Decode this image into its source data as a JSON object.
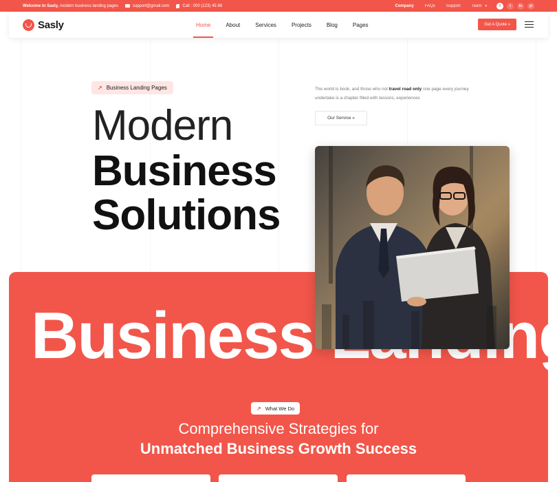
{
  "topbar": {
    "welcome_bold": "Welcome to Sasly,",
    "welcome_rest": "modern business landing pages",
    "email": "support@gmail.com",
    "phone": "Call : 000 (123) 45 88",
    "links": [
      "Company",
      "FAQs",
      "Support",
      "Team"
    ],
    "social": [
      "f",
      "t",
      "in",
      "yt"
    ]
  },
  "nav": {
    "logo": "Sasly",
    "menu": [
      "Home",
      "About",
      "Services",
      "Projects",
      "Blog",
      "Pages"
    ],
    "quote_button": "Get A Quote »"
  },
  "hero": {
    "badge": "Business Landing Pages",
    "heading_line1": "Modern",
    "heading_line2": "Business",
    "heading_line3": "Solutions",
    "intro_before": "The world is book, and those who not ",
    "intro_bold": "travel road only",
    "intro_after": " one page every journey undertake is a chapter filled with lessons, experiences",
    "service_button": "Our Service »"
  },
  "banner": {
    "big_text": "Business Landing",
    "section_badge": "What We Do",
    "subtitle1": "Comprehensive Strategies for",
    "subtitle2": "Unmatched Business Growth Success"
  },
  "colors": {
    "accent": "#f2564a",
    "badge_bg": "#fde6e4"
  },
  "icons": {
    "email": "mail-icon",
    "phone": "phone-icon",
    "menu": "hamburger-icon",
    "arrow": "arrow-up-right-icon"
  }
}
